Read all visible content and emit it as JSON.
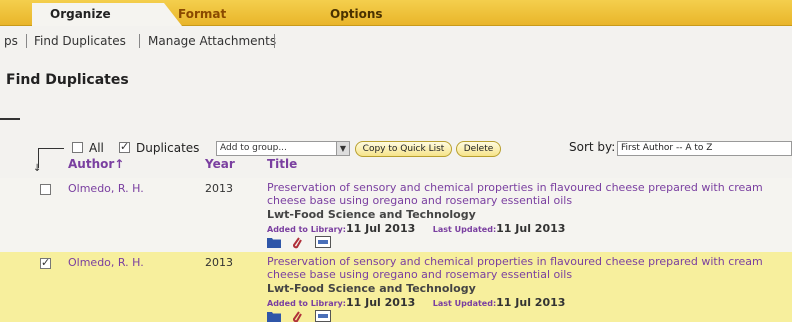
{
  "tabs": [
    {
      "label": "Organize",
      "active": true
    },
    {
      "label": "Format",
      "active": false
    },
    {
      "label": "Options",
      "active": false
    }
  ],
  "subnav": {
    "truncated_item": "ps",
    "items": [
      "Find Duplicates",
      "Manage Attachments"
    ]
  },
  "page_title": "Find Duplicates",
  "toolbar": {
    "all_label": "All",
    "all_checked": false,
    "duplicates_label": "Duplicates",
    "duplicates_checked": true,
    "add_to_group_value": "Add to group...",
    "copy_button": "Copy to Quick List",
    "delete_button": "Delete",
    "sort_label": "Sort by:",
    "sort_value": "First Author -- A to Z"
  },
  "columns": {
    "author": "Author",
    "year": "Year",
    "title": "Title"
  },
  "rows": [
    {
      "checked": false,
      "author": "Olmedo, R. H.",
      "year": "2013",
      "title": "Preservation of sensory and chemical properties in flavoured cheese prepared with cream cheese base using oregano and rosemary essential oils",
      "journal": "Lwt-Food Science and Technology",
      "added_label": "Added to Library:",
      "added_value": "11 Jul 2013",
      "updated_label": "Last Updated:",
      "updated_value": "11 Jul 2013",
      "highlighted": false
    },
    {
      "checked": true,
      "author": "Olmedo, R. H.",
      "year": "2013",
      "title": "Preservation of sensory and chemical properties in flavoured cheese prepared with cream cheese base using oregano and rosemary essential oils",
      "journal": "Lwt-Food Science and Technology",
      "added_label": "Added to Library:",
      "added_value": "11 Jul 2013",
      "updated_label": "Last Updated:",
      "updated_value": "11 Jul 2013",
      "highlighted": true
    }
  ],
  "colors": {
    "tab_bar": "#e9b52a",
    "link_purple": "#7a3fa0",
    "highlight_row": "#f7ef9d"
  },
  "icons": [
    "folder-icon",
    "paperclip-icon",
    "record-icon",
    "sort-arrow-icon",
    "dropdown-arrow-icon"
  ]
}
